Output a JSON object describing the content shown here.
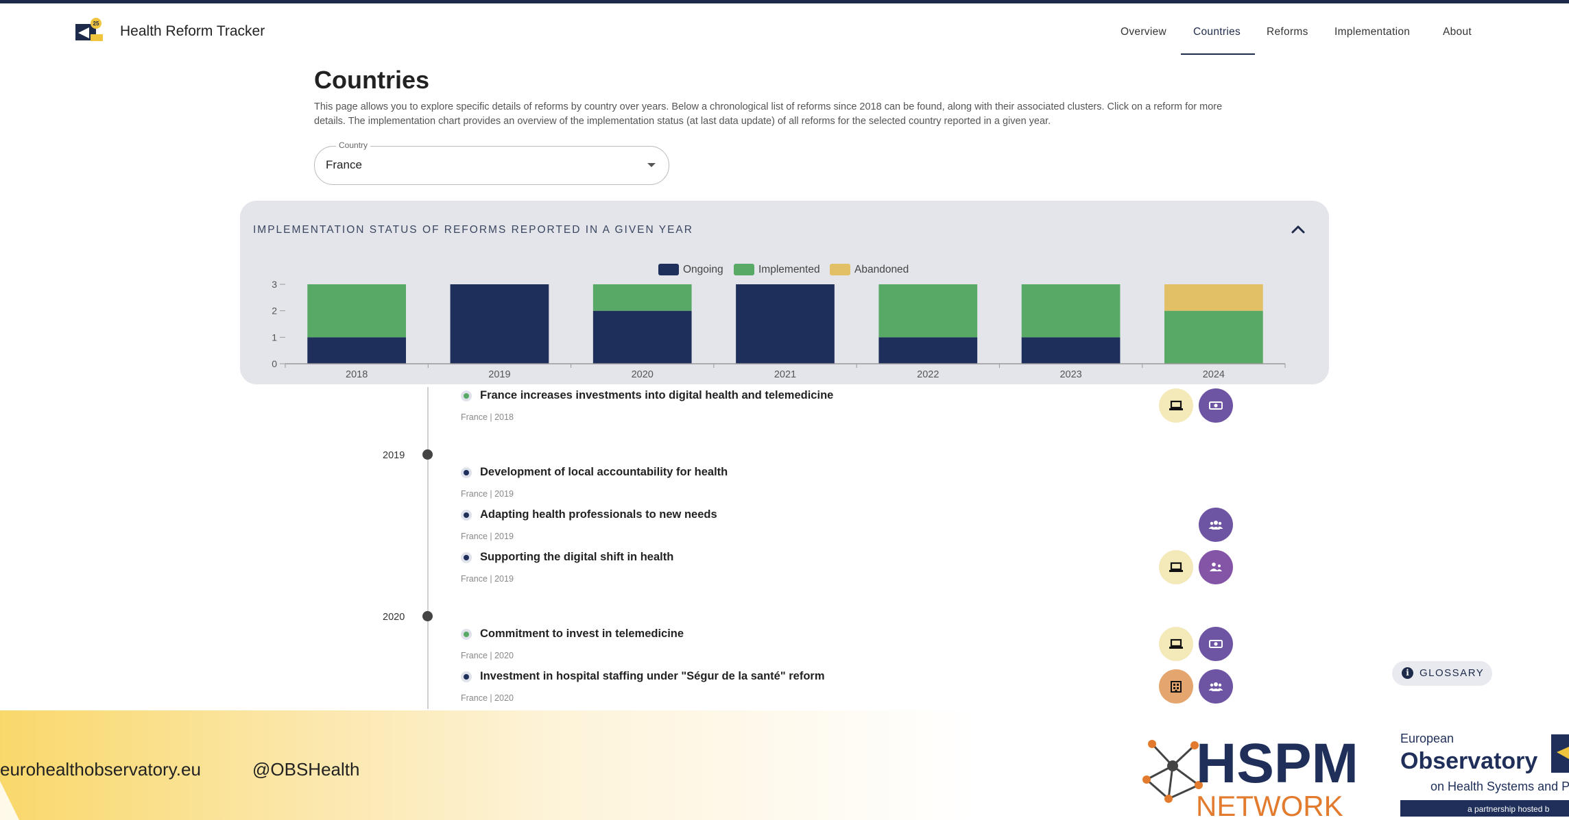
{
  "header": {
    "app_title": "Health Reform Tracker",
    "nav": [
      "Overview",
      "Countries",
      "Reforms",
      "Implementation",
      "About"
    ],
    "active_nav": "Countries"
  },
  "intro": {
    "title": "Countries",
    "description": "This page allows you to explore specific details of reforms by country over years. Below a chronological list of reforms since 2018 can be found, along with their associated clusters. Click on a reform for more details. The implementation chart provides an overview of the implementation status (at last data update) of all reforms for the selected country reported in a given year."
  },
  "country_select": {
    "label": "Country",
    "value": "France"
  },
  "chart_panel": {
    "heading": "IMPLEMENTATION STATUS OF REFORMS REPORTED IN A GIVEN YEAR",
    "collapse_icon": "chevron-up-icon"
  },
  "chart_data": {
    "type": "bar",
    "stacked": true,
    "categories": [
      "2018",
      "2019",
      "2020",
      "2021",
      "2022",
      "2023",
      "2024"
    ],
    "series": [
      {
        "name": "Ongoing",
        "color": "#1e2f5c",
        "values": [
          1,
          3,
          2,
          3,
          1,
          1,
          0
        ]
      },
      {
        "name": "Implemented",
        "color": "#58a866",
        "values": [
          2,
          0,
          1,
          0,
          2,
          2,
          2
        ]
      },
      {
        "name": "Abandoned",
        "color": "#e2c066",
        "values": [
          0,
          0,
          0,
          0,
          0,
          0,
          1
        ]
      }
    ],
    "ylim": [
      0,
      3
    ],
    "yticks": [
      "0",
      "1",
      "2",
      "3"
    ],
    "legend_position": "top-center",
    "grid": false
  },
  "timeline": {
    "years": [
      {
        "year": "2018",
        "reforms": [
          {
            "title": "France increases investments into digital health and telemedicine",
            "meta": "France | 2018",
            "status": "implemented",
            "status_color": "#58a866",
            "clusters": [
              {
                "icon": "laptop-icon",
                "bg": "#f4e9b8"
              },
              {
                "icon": "money-icon",
                "bg": "#6e55a3"
              }
            ]
          }
        ]
      },
      {
        "year": "2019",
        "reforms": [
          {
            "title": "Development of local accountability for health",
            "meta": "France | 2019",
            "status": "ongoing",
            "status_color": "#1e2f5c",
            "clusters": []
          },
          {
            "title": "Adapting health professionals to new needs",
            "meta": "France | 2019",
            "status": "ongoing",
            "status_color": "#1e2f5c",
            "clusters": [
              {
                "icon": "people-icon",
                "bg": "#6e55a3"
              }
            ]
          },
          {
            "title": "Supporting the digital shift in health",
            "meta": "France | 2019",
            "status": "ongoing",
            "status_color": "#1e2f5c",
            "clusters": [
              {
                "icon": "laptop-icon",
                "bg": "#f4e9b8"
              },
              {
                "icon": "hierarchy-icon",
                "bg": "#8455a6"
              }
            ]
          }
        ]
      },
      {
        "year": "2020",
        "reforms": [
          {
            "title": "Commitment to invest in telemedicine",
            "meta": "France | 2020",
            "status": "implemented",
            "status_color": "#58a866",
            "clusters": [
              {
                "icon": "laptop-icon",
                "bg": "#f4e9b8"
              },
              {
                "icon": "money-icon",
                "bg": "#6e55a3"
              }
            ]
          },
          {
            "title": "Investment in hospital staffing under \"Ségur de la santé\" reform",
            "meta": "France | 2020",
            "status": "ongoing",
            "status_color": "#1e2f5c",
            "clusters": [
              {
                "icon": "hospital-icon",
                "bg": "#e4a66e"
              },
              {
                "icon": "people-icon",
                "bg": "#6e55a3"
              }
            ]
          }
        ]
      }
    ]
  },
  "glossary": {
    "label": "GLOSSARY",
    "icon": "info-icon"
  },
  "footer": {
    "website": "eurohealthobservatory.eu",
    "social": "@OBSHealth",
    "logos": {
      "hspm": {
        "line1": "HSPM",
        "line2": "NETWORK"
      },
      "observatory": {
        "line1": "European",
        "line2": "Observatory",
        "line3": "on Health Systems and Po",
        "line4": "a partnership hosted b"
      }
    }
  }
}
